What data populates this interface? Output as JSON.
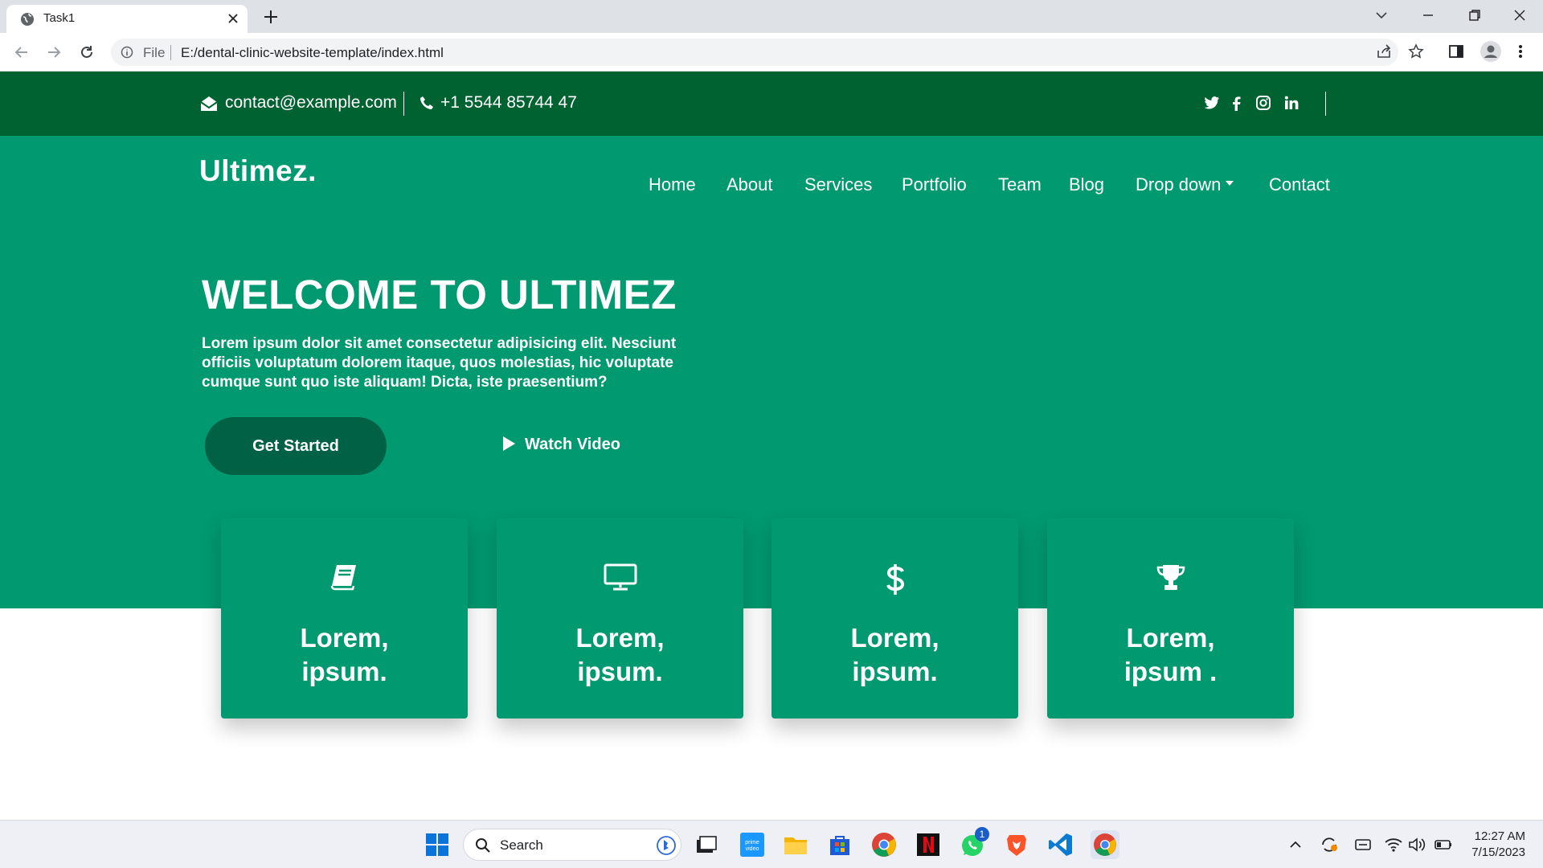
{
  "browser": {
    "tab_title": "Task1",
    "omnibox_scheme": "File",
    "url": "E:/dental-clinic-website-template/index.html"
  },
  "topbar": {
    "email": "contact@example.com",
    "phone": "+1 5544 85744 47",
    "social_icons": [
      "twitter-icon",
      "facebook-icon",
      "instagram-icon",
      "linkedin-icon"
    ]
  },
  "site": {
    "logo": "Ultimez.",
    "nav": [
      "Home",
      "About",
      "Services",
      "Portfolio",
      "Team",
      "Blog",
      "Drop down",
      "Contact"
    ],
    "hero": {
      "title": "WELCOME TO ULTIMEZ",
      "text": "Lorem ipsum dolor sit amet consectetur adipisicing elit. Nesciunt officiis voluptatum dolorem itaque, quos molestias, hic voluptate cumque sunt quo iste aliquam! Dicta, iste praesentium?",
      "primary_button": "Get Started",
      "secondary_button": "Watch Video"
    },
    "cards": [
      {
        "icon": "book-icon",
        "line1": "Lorem,",
        "line2": "ipsum."
      },
      {
        "icon": "monitor-icon",
        "line1": "Lorem,",
        "line2": "ipsum."
      },
      {
        "icon": "dollar-icon",
        "line1": "Lorem,",
        "line2": "ipsum."
      },
      {
        "icon": "trophy-icon",
        "line1": "Lorem,",
        "line2": "ipsum ."
      }
    ]
  },
  "taskbar": {
    "search_label": "Search",
    "whatsapp_badge": "1",
    "time": "12:27 AM",
    "date": "7/15/2023"
  },
  "colors": {
    "topbar": "#006231",
    "hero": "#009970",
    "primary_button": "#006144"
  }
}
